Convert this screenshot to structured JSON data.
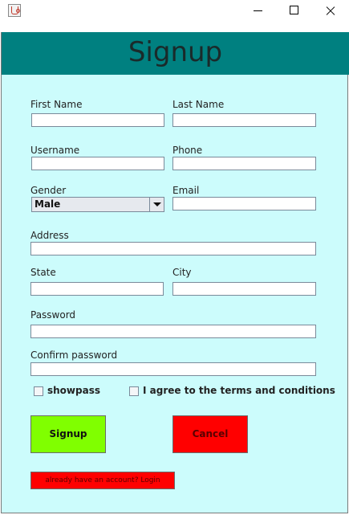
{
  "window": {
    "title": ""
  },
  "header": {
    "title": "Signup"
  },
  "form": {
    "first_name": {
      "label": "First Name",
      "value": ""
    },
    "last_name": {
      "label": "Last Name",
      "value": ""
    },
    "username": {
      "label": "Username",
      "value": ""
    },
    "phone": {
      "label": "Phone",
      "value": ""
    },
    "gender": {
      "label": "Gender",
      "value": "Male"
    },
    "email": {
      "label": "Email",
      "value": ""
    },
    "address": {
      "label": "Address",
      "value": ""
    },
    "state": {
      "label": "State",
      "value": ""
    },
    "city": {
      "label": "City",
      "value": ""
    },
    "password": {
      "label": "Password",
      "value": ""
    },
    "confirm_password": {
      "label": "Confirm password",
      "value": ""
    },
    "showpass": {
      "label": "showpass",
      "checked": false
    },
    "agree": {
      "label": "I agree to the terms and conditions",
      "checked": false
    }
  },
  "buttons": {
    "signup": "Signup",
    "cancel": "Cancel",
    "login": "already have an account? Login"
  },
  "colors": {
    "background": "#ccfcfc",
    "header": "#008080",
    "signup_button": "#80ff00",
    "cancel_button": "#ff0000",
    "login_button": "#ff0000"
  },
  "icons": {
    "app": "java-cup-icon",
    "minimize": "minimize-icon",
    "maximize": "maximize-icon",
    "close": "close-icon",
    "dropdown": "chevron-down-icon"
  }
}
